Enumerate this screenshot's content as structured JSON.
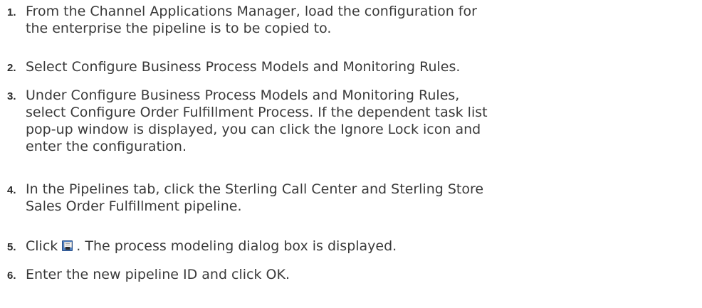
{
  "steps": [
    {
      "number": "1.",
      "lines": [
        "From the Channel Applications Manager, load the configuration for",
        "the enterprise the pipeline is to be copied to."
      ]
    },
    {
      "number": "2.",
      "lines": [
        "Select Configure Business Process Models and Monitoring Rules."
      ]
    },
    {
      "number": "3.",
      "lines": [
        "Under Configure Business Process Models and Monitoring Rules,",
        "select Configure Order Fulfillment Process. If the dependent task list",
        "pop-up window is displayed, you can click the Ignore Lock icon and",
        "enter the configuration."
      ]
    },
    {
      "number": "4.",
      "lines": [
        "In the Pipelines tab, click the Sterling Call Center and Sterling Store",
        "Sales Order Fulfillment pipeline."
      ]
    },
    {
      "number": "5.",
      "text_before_icon": "Click",
      "icon": "save-icon",
      "text_after_icon": ". The process modeling dialog box is displayed."
    },
    {
      "number": "6.",
      "lines": [
        "Enter the new pipeline ID and click OK."
      ]
    }
  ]
}
